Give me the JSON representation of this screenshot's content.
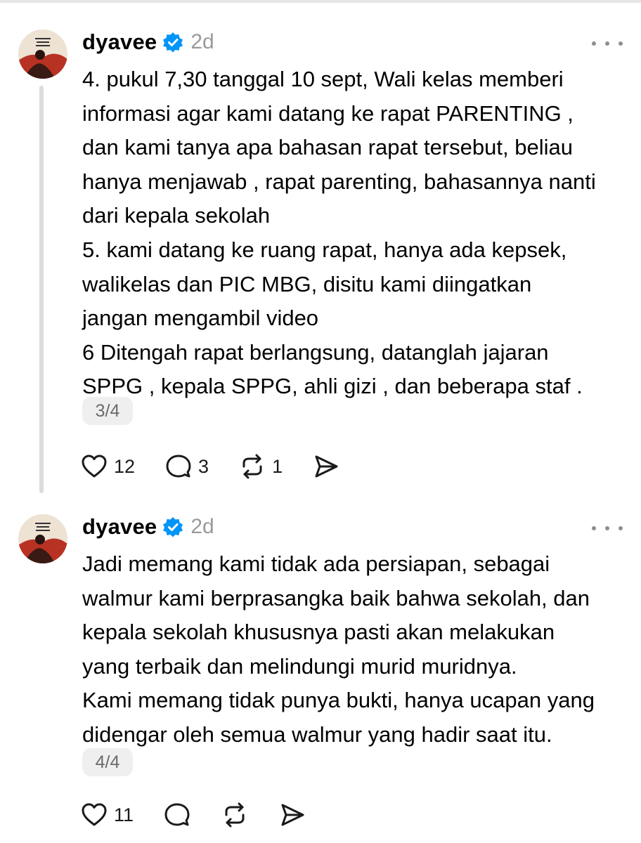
{
  "posts": [
    {
      "username": "dyavee",
      "time": "2d",
      "lines": [
        "4. pukul 7,30 tanggal 10 sept, Wali kelas memberi",
        "informasi agar kami datang ke rapat PARENTING ,",
        "dan kami tanya apa bahasan rapat tersebut, beliau",
        "hanya menjawab , rapat parenting, bahasannya nanti",
        "dari kepala sekolah",
        "5. kami datang ke ruang rapat, hanya ada kepsek,",
        "walikelas dan PIC MBG, disitu kami diingatkan",
        "jangan mengambil video",
        "6 Ditengah rapat berlangsung, datanglah jajaran",
        "SPPG , kepala SPPG,  ahli gizi , dan beberapa staf ."
      ],
      "pager": "3/4",
      "likes": "12",
      "replies": "3",
      "reposts": "1"
    },
    {
      "username": "dyavee",
      "time": "2d",
      "lines": [
        "Jadi memang kami tidak ada persiapan, sebagai",
        "walmur kami berprasangka baik bahwa sekolah, dan",
        "kepala sekolah khususnya pasti akan melakukan",
        "yang terbaik dan melindungi murid muridnya.",
        "Kami memang tidak punya bukti, hanya ucapan yang",
        "didengar oleh semua walmur yang hadir saat itu."
      ],
      "pager": "4/4",
      "likes": "11"
    }
  ],
  "icons": {
    "verified": "verified-badge-icon",
    "more": "more-options-icon",
    "like": "heart-icon",
    "reply": "comment-icon",
    "repost": "repost-icon",
    "share": "send-icon"
  },
  "colors": {
    "verified": "#0095f6",
    "muted": "#9a9a9a",
    "pager_bg": "#efefef"
  }
}
